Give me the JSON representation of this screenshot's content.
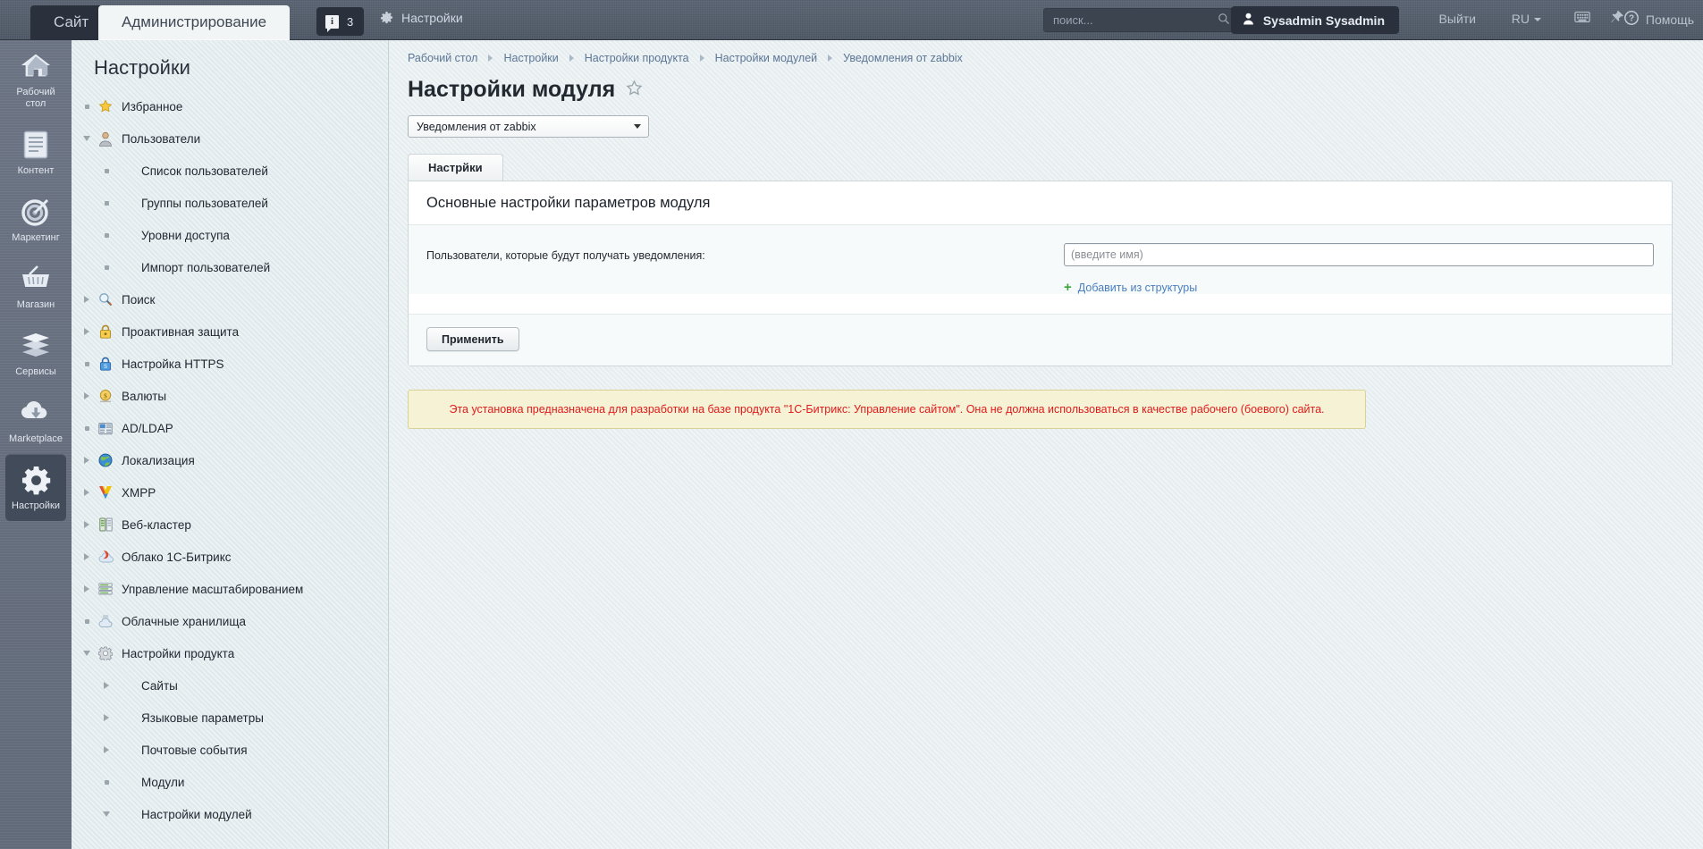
{
  "topbar": {
    "tab_site": "Сайт",
    "tab_admin": "Администрирование",
    "info_letter": "i",
    "info_count": "3",
    "settings_label": "Настройки",
    "search_placeholder": "поиск...",
    "search_value": "",
    "user_name": "Sysadmin Sysadmin",
    "logout_label": "Выйти",
    "lang_label": "RU",
    "help_label": "Помощь"
  },
  "rail": {
    "items": [
      {
        "label": "Рабочий стол",
        "icon": "home-icon",
        "active": false
      },
      {
        "label": "Контент",
        "icon": "document-icon",
        "active": false
      },
      {
        "label": "Маркетинг",
        "icon": "target-icon",
        "active": false
      },
      {
        "label": "Магазин",
        "icon": "basket-icon",
        "active": false
      },
      {
        "label": "Сервисы",
        "icon": "layers-icon",
        "active": false
      },
      {
        "label": "Marketplace",
        "icon": "cloud-download-icon",
        "active": false
      },
      {
        "label": "Настройки",
        "icon": "gear-icon",
        "active": true
      }
    ]
  },
  "sidebar": {
    "title": "Настройки",
    "items": [
      {
        "label": "Избранное",
        "level": 1,
        "expander": "dot",
        "icon": "star-icon"
      },
      {
        "label": "Пользователи",
        "level": 1,
        "expander": "down",
        "icon": "user-icon"
      },
      {
        "label": "Список пользователей",
        "level": 2,
        "expander": "dot",
        "icon": "none"
      },
      {
        "label": "Группы пользователей",
        "level": 2,
        "expander": "dot",
        "icon": "none"
      },
      {
        "label": "Уровни доступа",
        "level": 2,
        "expander": "dot",
        "icon": "none"
      },
      {
        "label": "Импорт пользователей",
        "level": 2,
        "expander": "dot",
        "icon": "none"
      },
      {
        "label": "Поиск",
        "level": 1,
        "expander": "right",
        "icon": "magnifier-icon"
      },
      {
        "label": "Проактивная защита",
        "level": 1,
        "expander": "right",
        "icon": "lock-icon"
      },
      {
        "label": "Настройка HTTPS",
        "level": 1,
        "expander": "dot",
        "icon": "ssl-lock-icon"
      },
      {
        "label": "Валюты",
        "level": 1,
        "expander": "right",
        "icon": "coin-icon"
      },
      {
        "label": "AD/LDAP",
        "level": 1,
        "expander": "dot",
        "icon": "ldap-icon"
      },
      {
        "label": "Локализация",
        "level": 1,
        "expander": "right",
        "icon": "globe-icon"
      },
      {
        "label": "XMPP",
        "level": 1,
        "expander": "right",
        "icon": "xmpp-icon"
      },
      {
        "label": "Веб-кластер",
        "level": 1,
        "expander": "right",
        "icon": "server-icon"
      },
      {
        "label": "Облако 1С-Битрикс",
        "level": 1,
        "expander": "right",
        "icon": "cloud-bitrix-icon"
      },
      {
        "label": "Управление масштабированием",
        "level": 1,
        "expander": "right",
        "icon": "scale-icon"
      },
      {
        "label": "Облачные хранилища",
        "level": 1,
        "expander": "dot",
        "icon": "cloud-storage-icon"
      },
      {
        "label": "Настройки продукта",
        "level": 1,
        "expander": "down",
        "icon": "gear-small-icon"
      },
      {
        "label": "Сайты",
        "level": 2,
        "expander": "right",
        "icon": "none"
      },
      {
        "label": "Языковые параметры",
        "level": 2,
        "expander": "right",
        "icon": "none"
      },
      {
        "label": "Почтовые события",
        "level": 2,
        "expander": "right",
        "icon": "none"
      },
      {
        "label": "Модули",
        "level": 2,
        "expander": "dot",
        "icon": "none"
      },
      {
        "label": "Настройки модулей",
        "level": 2,
        "expander": "down",
        "icon": "none"
      }
    ]
  },
  "main": {
    "breadcrumb": [
      "Рабочий стол",
      "Настройки",
      "Настройки продукта",
      "Настройки модулей",
      "Уведомления от zabbix"
    ],
    "page_title": "Настройки модуля",
    "module_select_value": "Уведомления от zabbix",
    "tabs": [
      {
        "label": "Настрйки",
        "active": true
      }
    ],
    "panel_heading": "Основные настройки параметров модуля",
    "form": {
      "label": "Пользователи, которые будут получать уведомления:",
      "input_value": "",
      "input_placeholder": "(введите имя)",
      "add_link": "Добавить из структуры",
      "apply_button": "Применить"
    },
    "warning": "Эта установка предназначена для разработки на базе продукта \"1С-Битрикс: Управление сайтом\". Она не должна использоваться в качестве рабочего (боевого) сайта."
  },
  "colors": {
    "topbar_bg": "#555f6e",
    "rail_bg": "#6b7484",
    "sidebar_bg": "#e2ecee",
    "accent_link": "#4a7fbf",
    "warning_text": "#e01b1b",
    "warning_bg": "#f6f2d6"
  }
}
